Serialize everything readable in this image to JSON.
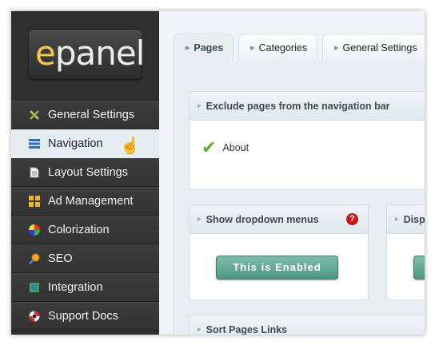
{
  "logo": {
    "first_letter": "e",
    "rest": "panel"
  },
  "sidebar": {
    "items": [
      {
        "label": "General Settings",
        "icon": "tools-icon"
      },
      {
        "label": "Navigation",
        "icon": "navigation-icon",
        "active": true
      },
      {
        "label": "Layout Settings",
        "icon": "document-icon"
      },
      {
        "label": "Ad Management",
        "icon": "grid-icon"
      },
      {
        "label": "Colorization",
        "icon": "color-wheel-icon"
      },
      {
        "label": "SEO",
        "icon": "magnifier-icon"
      },
      {
        "label": "Integration",
        "icon": "puzzle-icon"
      },
      {
        "label": "Support Docs",
        "icon": "lifebuoy-icon"
      }
    ]
  },
  "tabs": [
    "Pages",
    "Categories",
    "General Settings"
  ],
  "panels": {
    "exclude": {
      "title": "Exclude pages from the navigation bar",
      "items": [
        "About"
      ]
    },
    "dropdown": {
      "title": "Show dropdown menus",
      "help": "?",
      "button_label": "This is Enabled"
    },
    "display": {
      "title": "Displ"
    },
    "sort": {
      "title": "Sort Pages Links"
    }
  },
  "colors": {
    "sidebar_bg": "#2f2f2f",
    "accent_button": "#5fa38e",
    "check": "#5cae27",
    "help": "#d01414"
  }
}
